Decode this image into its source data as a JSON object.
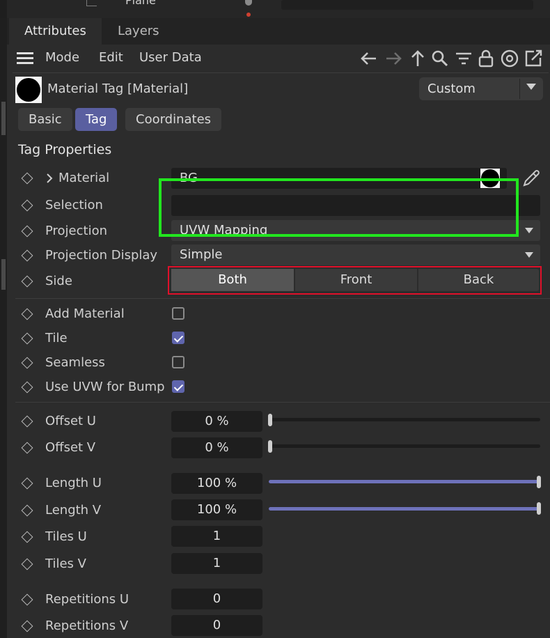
{
  "top_strip": {
    "object_label": "Plane"
  },
  "tabs": [
    {
      "label": "Attributes",
      "active": true
    },
    {
      "label": "Layers",
      "active": false
    }
  ],
  "menu": {
    "items": [
      "Mode",
      "Edit",
      "User Data"
    ]
  },
  "nav_icons": [
    "back-arrow-icon",
    "forward-arrow-icon",
    "up-arrow-icon",
    "search-icon",
    "filter-icon",
    "lock-icon",
    "target-icon",
    "new-window-icon"
  ],
  "header": {
    "title": "Material Tag [Material]",
    "preset": "Custom"
  },
  "subtabs": [
    "Basic",
    "Tag",
    "Coordinates"
  ],
  "section_title": "Tag Properties",
  "props": {
    "material": {
      "label": "Material",
      "value": "BG"
    },
    "selection": {
      "label": "Selection",
      "value": ""
    },
    "projection": {
      "label": "Projection",
      "value": "UVW Mapping"
    },
    "projection_display": {
      "label": "Projection Display",
      "value": "Simple"
    },
    "side": {
      "label": "Side",
      "options": [
        "Both",
        "Front",
        "Back"
      ],
      "selected": "Both"
    },
    "add_material": {
      "label": "Add Material",
      "checked": false
    },
    "tile": {
      "label": "Tile",
      "checked": true
    },
    "seamless": {
      "label": "Seamless",
      "checked": false
    },
    "use_uvw_bump": {
      "label": "Use UVW for Bump",
      "checked": true
    },
    "offset_u": {
      "label": "Offset U",
      "value": "0 %",
      "fraction": 0
    },
    "offset_v": {
      "label": "Offset V",
      "value": "0 %",
      "fraction": 0
    },
    "length_u": {
      "label": "Length U",
      "value": "100 %",
      "fraction": 1
    },
    "length_v": {
      "label": "Length V",
      "value": "100 %",
      "fraction": 1
    },
    "tiles_u": {
      "label": "Tiles U",
      "value": "1"
    },
    "tiles_v": {
      "label": "Tiles V",
      "value": "1"
    },
    "repetitions_u": {
      "label": "Repetitions U",
      "value": "0"
    },
    "repetitions_v": {
      "label": "Repetitions V",
      "value": "0"
    }
  },
  "colors": {
    "accent": "#5f65ad",
    "highlight_red": "#e0102a",
    "highlight_green": "#22e61f"
  }
}
